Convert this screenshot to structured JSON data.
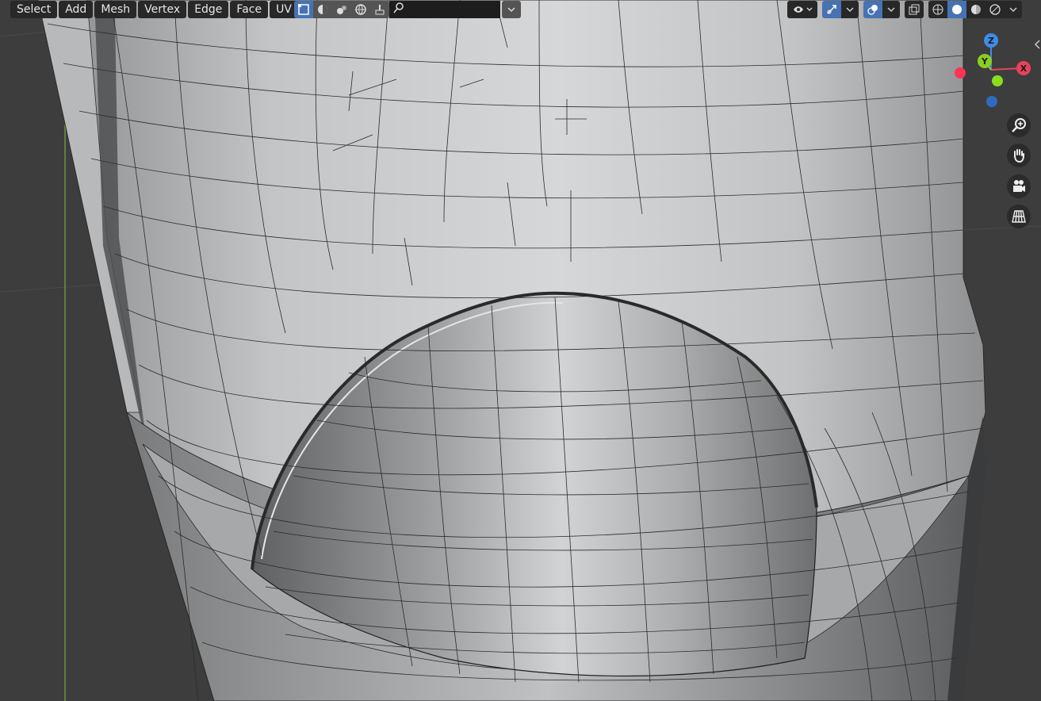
{
  "header": {
    "menus": [
      {
        "id": "select",
        "label": "Select"
      },
      {
        "id": "add",
        "label": "Add"
      },
      {
        "id": "mesh",
        "label": "Mesh"
      },
      {
        "id": "vertex",
        "label": "Vertex"
      },
      {
        "id": "edge",
        "label": "Edge"
      },
      {
        "id": "face",
        "label": "Face"
      },
      {
        "id": "uv",
        "label": "UV"
      }
    ],
    "search": {
      "placeholder": ""
    }
  },
  "gizmo": {
    "x_label": "X",
    "y_label": "Y",
    "z_label": "Z"
  },
  "colors": {
    "header_button": "#282828",
    "active_toggle": "#4772b3",
    "axis_x": "#e8415b",
    "axis_y": "#8bce1f",
    "axis_z": "#3f8ce8",
    "mesh_face": "#c9cacb",
    "background": "#3d3d3d"
  },
  "icons": [
    "vertex-select-icon",
    "xray-icon",
    "shading-icon",
    "global-icon",
    "brush-icon",
    "search-icon",
    "visibility-icon",
    "gizmo-icon",
    "overlay-icon",
    "toggle-xray-icon",
    "wireframe-shading-icon",
    "solid-shading-icon",
    "material-shading-icon",
    "rendered-shading-icon",
    "zoom-icon",
    "pan-hand-icon",
    "camera-icon",
    "perspective-grid-icon"
  ]
}
